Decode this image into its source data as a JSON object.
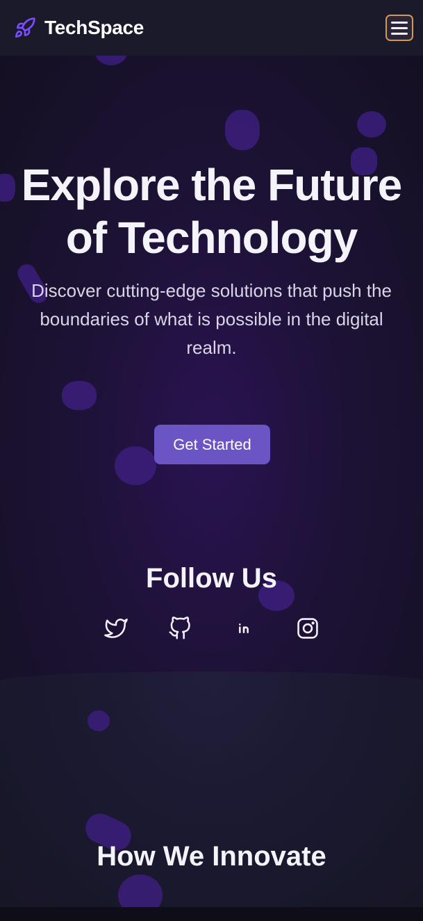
{
  "header": {
    "brand_name": "TechSpace",
    "brand_icon": "rocket-icon",
    "menu_icon": "hamburger-menu-icon"
  },
  "hero": {
    "title_line1": "Explore the Future",
    "title_line2": "of Technology",
    "subtitle_line1": "Discover cutting-edge solutions that push the",
    "subtitle_line2": "boundaries of what is possible in the digital",
    "subtitle_line3": "realm.",
    "cta_label": "Get Started"
  },
  "follow": {
    "title": "Follow Us",
    "icons": [
      "twitter-icon",
      "github-icon",
      "linkedin-icon",
      "instagram-icon"
    ]
  },
  "section": {
    "title": "How We Innovate"
  },
  "colors": {
    "accent": "#6b55c4",
    "brand_icon": "#7c4dff",
    "menu_border": "#d49a4a",
    "background": "#171626"
  }
}
